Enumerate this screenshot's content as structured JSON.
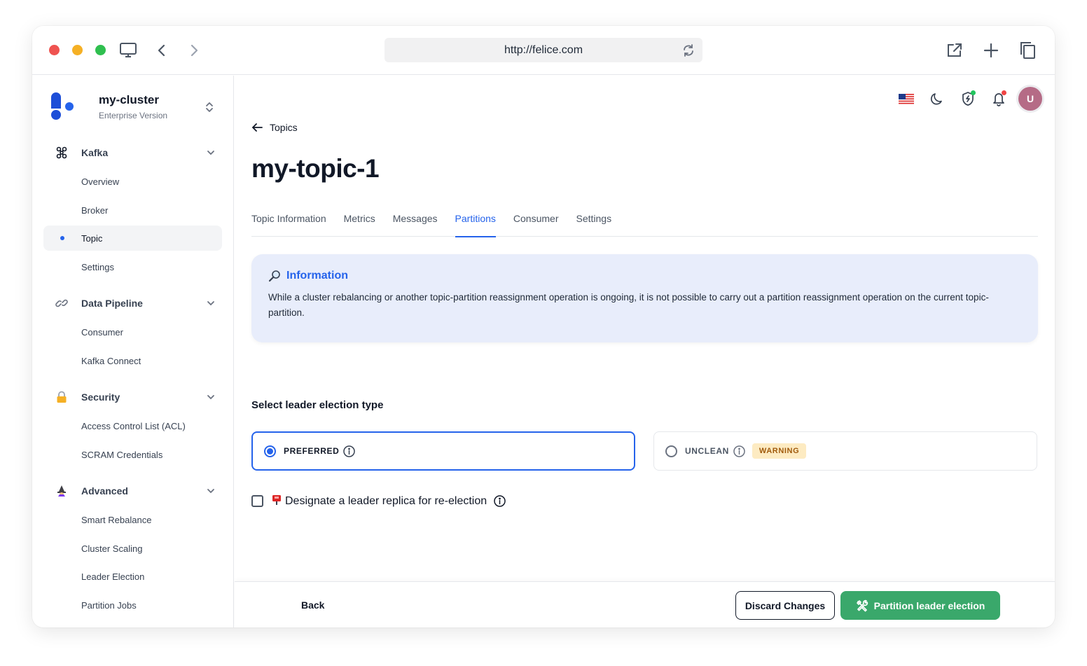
{
  "browser": {
    "url": "http://felice.com",
    "icons": [
      "monitor-icon",
      "chevron-left-icon",
      "chevron-right-icon",
      "reload-icon",
      "external-link-icon",
      "plus-icon",
      "copy-icon"
    ]
  },
  "sidebar": {
    "cluster_name": "my-cluster",
    "cluster_edition": "Enterprise Version",
    "sections": [
      {
        "label": "Kafka",
        "icon": "kafka-icon",
        "items": [
          "Overview",
          "Broker",
          "Topic",
          "Settings"
        ]
      },
      {
        "label": "Data Pipeline",
        "icon": "link-icon",
        "items": [
          "Consumer",
          "Kafka Connect"
        ]
      },
      {
        "label": "Security",
        "icon": "lock-icon",
        "items": [
          "Access Control List (ACL)",
          "SCRAM Credentials"
        ]
      },
      {
        "label": "Advanced",
        "icon": "wizard-icon",
        "items": [
          "Smart Rebalance",
          "Cluster Scaling",
          "Leader Election",
          "Partition Jobs"
        ]
      }
    ],
    "active_item": "Topic"
  },
  "header": {
    "icons": [
      "us-flag-icon",
      "moon-icon",
      "shield-icon",
      "bell-icon"
    ],
    "avatar_initial": "U",
    "shield_badge_color": "#22c55e",
    "bell_badge_color": "#ef4444"
  },
  "page": {
    "breadcrumb": "Topics",
    "title": "my-topic-1",
    "tabs": [
      "Topic Information",
      "Metrics",
      "Messages",
      "Partitions",
      "Consumer",
      "Settings"
    ],
    "active_tab": "Partitions"
  },
  "info": {
    "title": "Information",
    "text": "While a cluster rebalancing or another topic-partition reassignment operation is ongoing, it is not possible to carry out a partition reassignment operation on the current topic-partition."
  },
  "election": {
    "label": "Select leader election type",
    "options": [
      {
        "label": "PREFERRED",
        "selected": true
      },
      {
        "label": "UNCLEAN",
        "selected": false,
        "badge": "WARNING"
      }
    ],
    "designate_label": "Designate a leader replica for re-election",
    "designate_checked": false
  },
  "footer": {
    "back": "Back",
    "discard": "Discard Changes",
    "submit": "Partition leader election"
  },
  "colors": {
    "accent": "#2563eb",
    "success": "#3aa86b",
    "info_bg": "#e8edfb",
    "warning_bg": "#fdebc2",
    "warning_text": "#a05a0c"
  }
}
